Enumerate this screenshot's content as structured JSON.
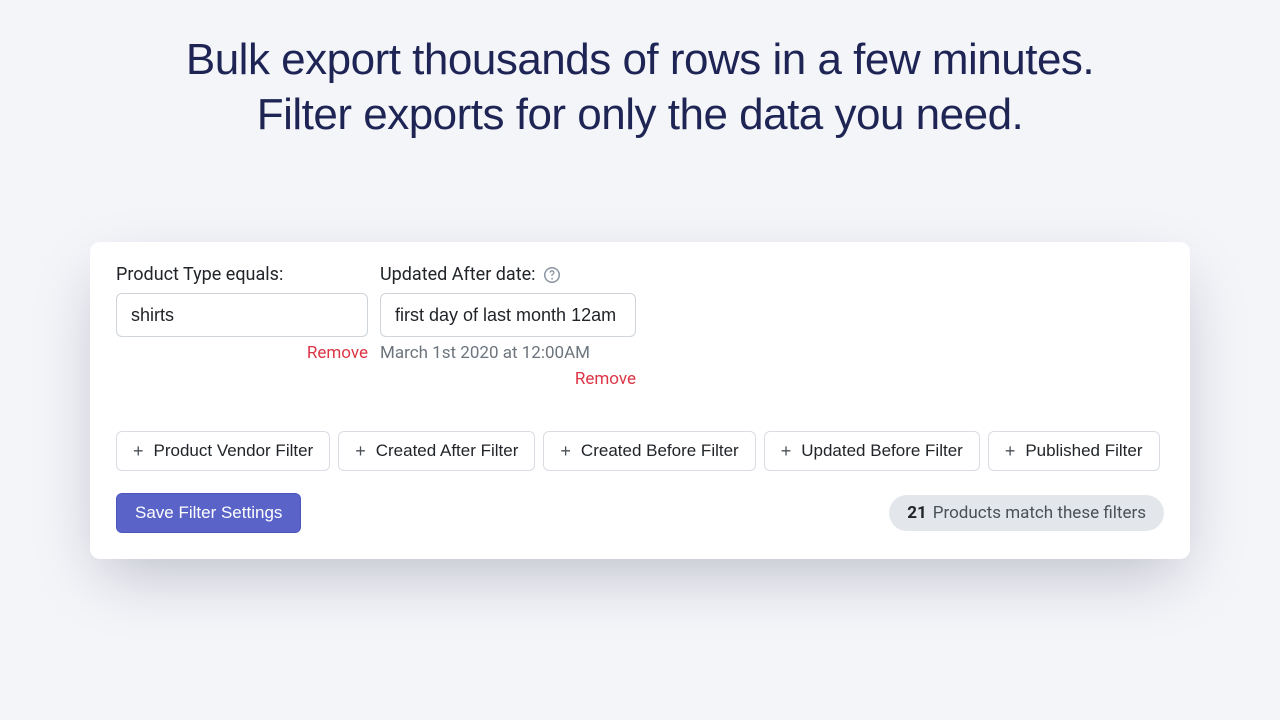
{
  "hero": {
    "line1": "Bulk export thousands of rows in a few minutes.",
    "line2": "Filter exports for only the data you need."
  },
  "filters": {
    "productType": {
      "label": "Product Type equals:",
      "value": "shirts",
      "removeLabel": "Remove"
    },
    "updatedAfter": {
      "label": "Updated After date:",
      "value": "first day of last month 12am",
      "resolved": "March 1st 2020 at 12:00AM",
      "removeLabel": "Remove"
    }
  },
  "addFilterButtons": [
    {
      "label": "Product Vendor Filter"
    },
    {
      "label": "Created After Filter"
    },
    {
      "label": "Created Before Filter"
    },
    {
      "label": "Updated Before Filter"
    },
    {
      "label": "Published Filter"
    }
  ],
  "saveButton": "Save Filter Settings",
  "matchSummary": {
    "count": "21",
    "text": "Products match these filters"
  }
}
